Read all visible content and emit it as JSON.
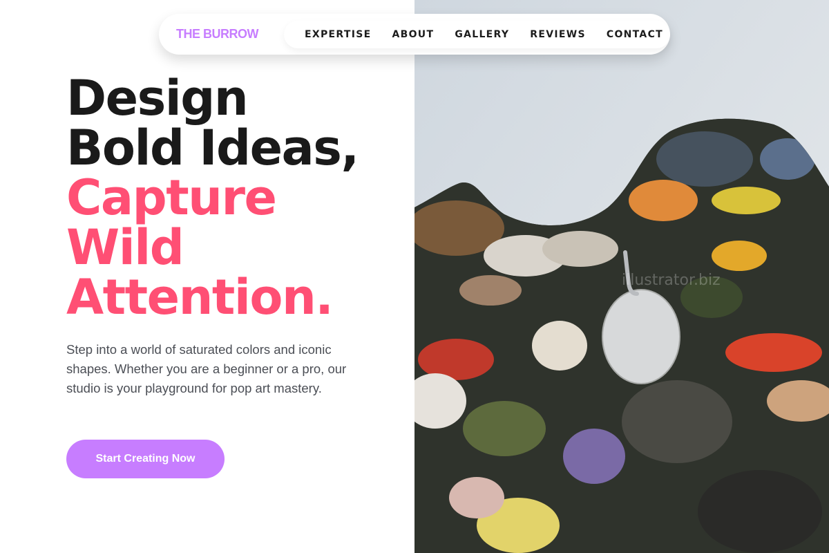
{
  "brand": "THE BURROW",
  "nav": {
    "items": [
      "EXPERTISE",
      "ABOUT",
      "GALLERY",
      "REVIEWS",
      "CONTACT"
    ]
  },
  "hero": {
    "headline_lines_dark": [
      "Design",
      "Bold Ideas,"
    ],
    "headline_lines_accent": [
      "Capture",
      "Wild",
      "Attention."
    ],
    "lead": "Step into a world of saturated colors and iconic shapes. Whether you are a beginner or a pro, our studio is your playground for pop art mastery.",
    "cta_label": "Start Creating Now",
    "image_watermark": "illustrator.biz"
  },
  "colors": {
    "accent": "#c77dff",
    "headline_accent": "#ff4f74",
    "headline_dark": "#1a1a1a",
    "body_text": "#4b4e55"
  }
}
